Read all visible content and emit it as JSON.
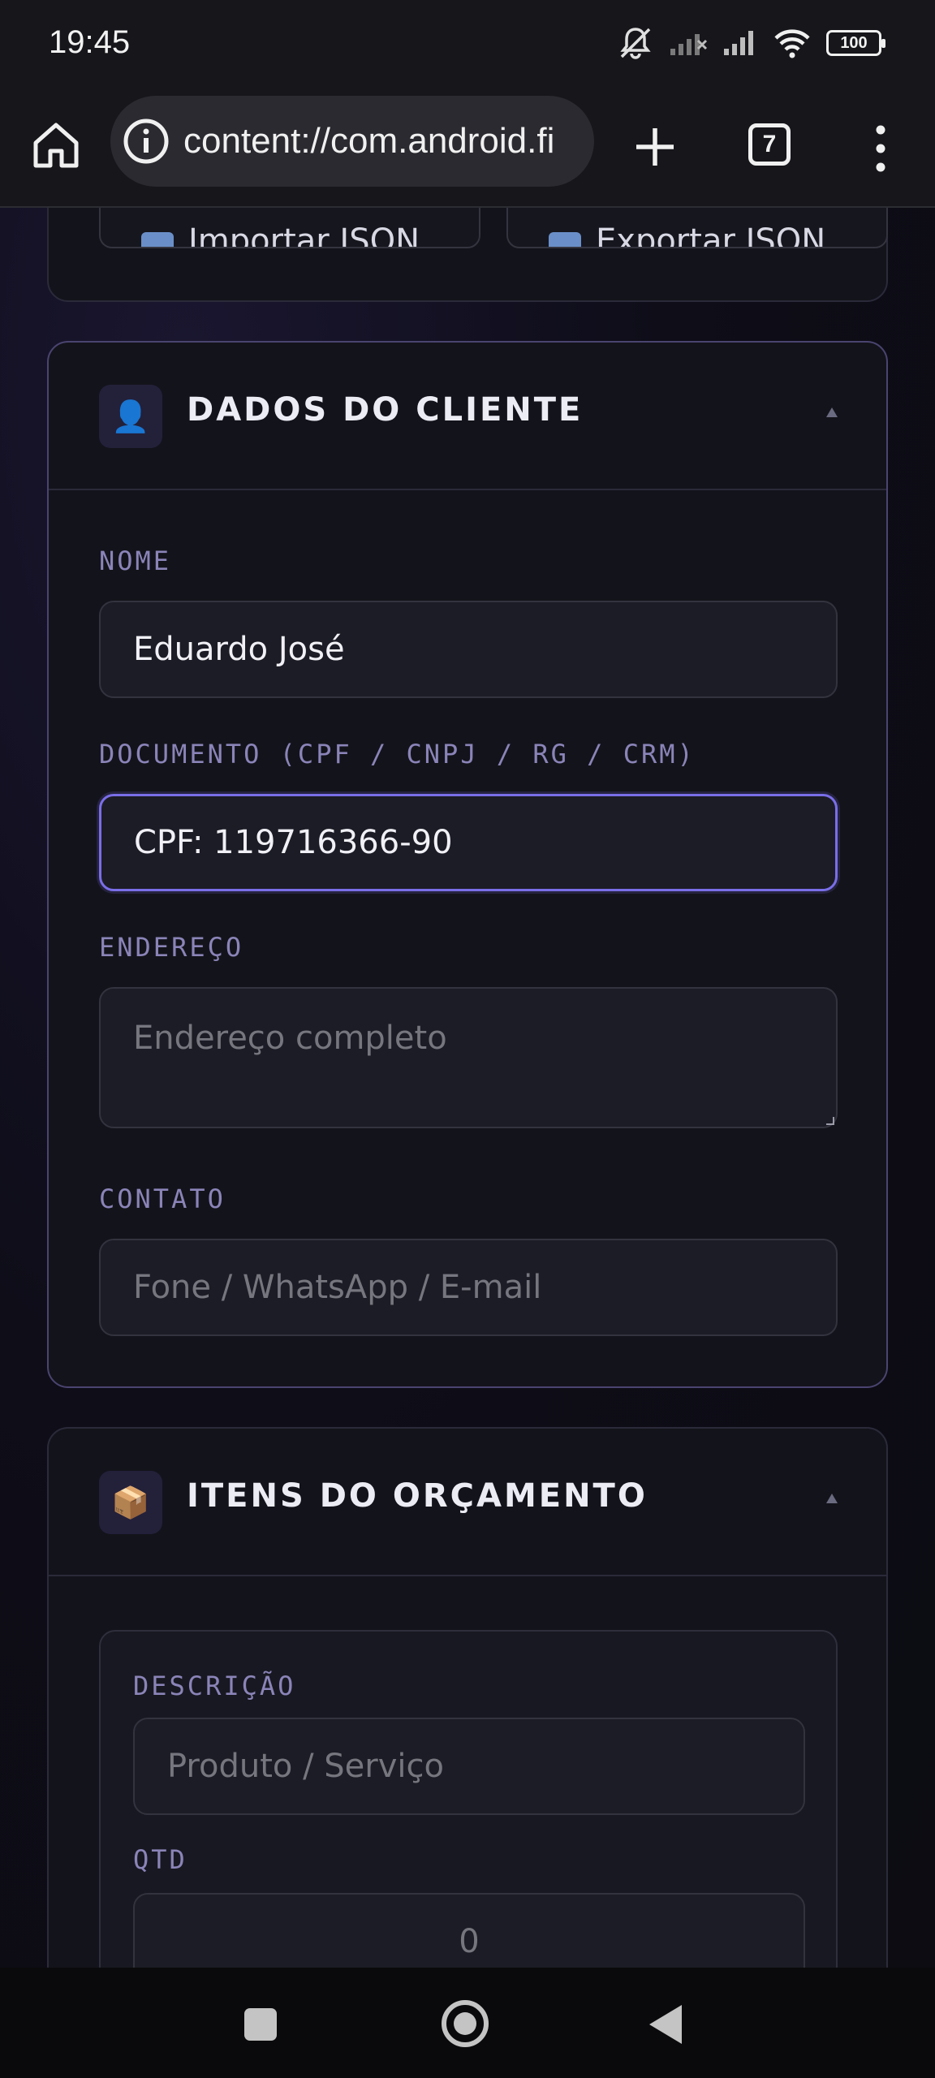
{
  "status_bar": {
    "time": "19:45",
    "battery": "100",
    "icons": [
      "mute-bell-icon",
      "signal-1-icon",
      "signal-2-icon",
      "wifi-icon",
      "battery-icon"
    ]
  },
  "browser": {
    "url": "content://com.android.fi",
    "tab_count": "7",
    "icons": [
      "home-icon",
      "info-icon",
      "plus-icon",
      "tabs-icon",
      "more-vert-icon"
    ]
  },
  "io_card": {
    "import_label": "Importar JSON",
    "export_label": "Exportar JSON"
  },
  "client_section": {
    "emoji": "👤",
    "title": "DADOS DO CLIENTE",
    "fields": {
      "name": {
        "label": "NOME",
        "value": "Eduardo José"
      },
      "document": {
        "label": "DOCUMENTO (CPF / CNPJ / RG / CRM)",
        "value": "CPF: 119716366-90"
      },
      "address": {
        "label": "ENDEREÇO",
        "placeholder": "Endereço completo"
      },
      "contact": {
        "label": "CONTATO",
        "placeholder": "Fone / WhatsApp / E-mail"
      }
    }
  },
  "items_section": {
    "emoji": "📦",
    "title": "ITENS DO ORÇAMENTO",
    "fields": {
      "description": {
        "label": "DESCRIÇÃO",
        "placeholder": "Produto / Serviço"
      },
      "qty": {
        "label": "QTD",
        "placeholder": "0"
      }
    }
  },
  "colors": {
    "accent": "#7a6ee8",
    "label": "#8a84b8",
    "card_bg": "#13131b",
    "field_bg": "#1c1c26"
  }
}
